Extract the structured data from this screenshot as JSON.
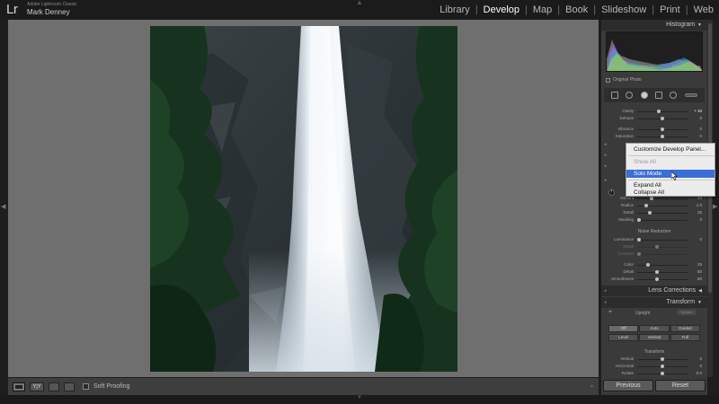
{
  "app": {
    "logo": "Lr",
    "product": "Adobe Lightroom Classic",
    "user": "Mark Denney"
  },
  "modules": [
    "Library",
    "Develop",
    "Map",
    "Book",
    "Slideshow",
    "Print",
    "Web"
  ],
  "active_module": "Develop",
  "toolbar": {
    "yy_label": "Y|Y",
    "soft_proofing_label": "Soft Proofing"
  },
  "right_panel": {
    "histogram_title": "Histogram",
    "hist_info": [
      "ISO 100",
      "1/60 sec",
      "f / 11",
      "0"
    ],
    "original_photo_label": "Original Photo",
    "presence_sliders": [
      {
        "label": "Clarity",
        "value": "+ 10"
      },
      {
        "label": "Dehaze",
        "value": "0"
      },
      {
        "label": "Vibrance",
        "value": "0"
      },
      {
        "label": "Saturation",
        "value": "0"
      }
    ],
    "sharpening_sliders": [
      {
        "label": "Amount",
        "value": "40"
      },
      {
        "label": "Radius",
        "value": "1.0"
      },
      {
        "label": "Detail",
        "value": "25"
      },
      {
        "label": "Masking",
        "value": "0"
      }
    ],
    "noise_reduction_title": "Noise Reduction",
    "noise_sliders": [
      {
        "label": "Luminance",
        "value": "0"
      },
      {
        "label": "Detail",
        "value": ""
      },
      {
        "label": "Contrast",
        "value": ""
      },
      {
        "label": "Color",
        "value": "25"
      },
      {
        "label": "Detail",
        "value": "50"
      },
      {
        "label": "Smoothness",
        "value": "50"
      }
    ],
    "lens_corrections_title": "Lens Corrections",
    "transform_title": "Transform",
    "upright_label": "Upright",
    "upright_pill": "Update",
    "upright_buttons_row1": [
      "Off",
      "Auto",
      "Guided"
    ],
    "upright_buttons_row2": [
      "Level",
      "Vertical",
      "Full"
    ],
    "transform_sub_title": "Transform",
    "transform_sliders": [
      {
        "label": "Vertical",
        "value": "0"
      },
      {
        "label": "Horizontal",
        "value": "0"
      },
      {
        "label": "Rotate",
        "value": "0.0"
      }
    ],
    "previous_label": "Previous",
    "reset_label": "Reset"
  },
  "context_menu": {
    "items": [
      {
        "label": "Customize Develop Panel...",
        "state": "normal"
      },
      {
        "label": "Show All",
        "state": "disabled"
      },
      {
        "label": "Solo Mode",
        "state": "highlighted"
      },
      {
        "label": "Expand All",
        "state": "normal"
      },
      {
        "label": "Collapse All",
        "state": "normal"
      }
    ]
  },
  "colors": {
    "work_area": "#6f6f6f",
    "panel": "#3a3a3a",
    "menu_highlight": "#3b6ed6"
  }
}
